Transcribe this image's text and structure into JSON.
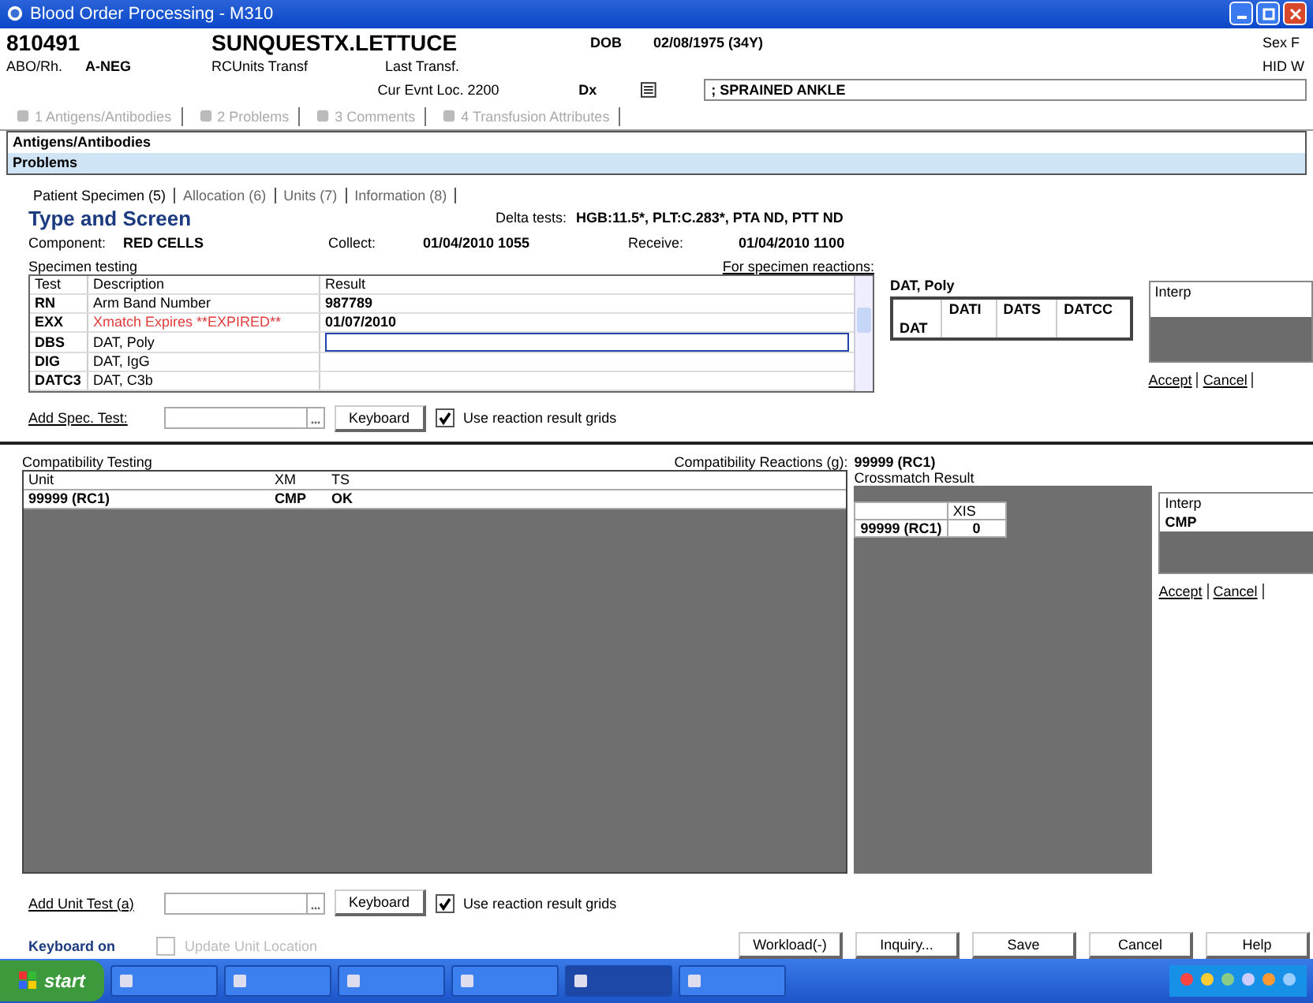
{
  "window": {
    "title": "Blood Order Processing - M310"
  },
  "header": {
    "mrn": "810491",
    "name": "SUNQUESTX.LETTUCE",
    "dob_label": "DOB",
    "dob": "02/08/1975 (34Y)",
    "sex_label": "Sex",
    "sex": "F",
    "abo_label": "ABO/Rh.",
    "abo": "A-NEG",
    "rc_label": "RCUnits Transf",
    "last_transf": "Last Transf.",
    "location": "Cur Evnt Loc. 2200",
    "dx_label": "Dx",
    "diagnosis": "; SPRAINED ANKLE",
    "hid_label": "HID",
    "hid": "W"
  },
  "section_tabs": [
    {
      "label": "1 Antigens/Antibodies",
      "disabled": true
    },
    {
      "label": "2 Problems",
      "disabled": true
    },
    {
      "label": "3 Comments",
      "disabled": true
    },
    {
      "label": "4 Transfusion Attributes",
      "disabled": true
    }
  ],
  "section_bars": [
    {
      "label": "Antigens/Antibodies",
      "selected": false
    },
    {
      "label": "Problems",
      "selected": true
    }
  ],
  "sub_tabs": [
    {
      "label": "Patient Specimen (5)",
      "selected": true
    },
    {
      "label": "Allocation (6)",
      "selected": false
    },
    {
      "label": "Units (7)",
      "selected": false
    },
    {
      "label": "Information (8)",
      "selected": false
    }
  ],
  "heading": "Type and Screen",
  "delta_label": "Delta tests:",
  "delta": "HGB:11.5*, PLT:C.283*, PTA ND, PTT ND",
  "component_label": "Component:",
  "component": "RED CELLS",
  "collect_label": "Collect:",
  "collect": "01/04/2010 1055",
  "receive_label": "Receive:",
  "receive": "01/04/2010 1100",
  "specimen": {
    "label": "Specimen testing",
    "link": "For specimen reactions:",
    "columns": [
      "Test",
      "Description",
      "Result"
    ],
    "rows": [
      {
        "test": "RN",
        "description": "Arm Band Number",
        "result": "987789",
        "alert": false,
        "editing": false
      },
      {
        "test": "EXX",
        "description": "Xmatch Expires **EXPIRED**",
        "result": "01/07/2010",
        "alert": true,
        "editing": false
      },
      {
        "test": "DBS",
        "description": "DAT, Poly",
        "result": "",
        "alert": false,
        "editing": true
      },
      {
        "test": "DIG",
        "description": "DAT, IgG",
        "alert": false,
        "editing": false
      },
      {
        "test": "DATC3",
        "description": "DAT, C3b",
        "alert": false,
        "editing": false
      }
    ]
  },
  "dat": {
    "title": "DAT, Poly",
    "columns": [
      "DATI",
      "DATS",
      "DATCC"
    ],
    "row": "DAT"
  },
  "interp": {
    "label": "Interp",
    "accept": "Accept",
    "cancel": "Cancel"
  },
  "add_spec": {
    "label": "Add Spec. Test:",
    "keyboard": "Keyboard",
    "checkbox": {
      "label": "Use reaction result grids",
      "checked": true
    }
  },
  "compat": {
    "title": "Compatibility Testing",
    "reactions_label": "Compatibility Reactions (g):",
    "reactions_unit": "99999 (RC1)",
    "columns": [
      "Unit",
      "XM",
      "TS"
    ],
    "rows": [
      [
        "99999 (RC1)",
        "CMP",
        "OK"
      ]
    ],
    "crossmatch_title": "Crossmatch Result",
    "xm_column": "XIS",
    "xm_rows": [
      {
        "unit": "99999 (RC1)",
        "value": "0"
      }
    ],
    "interp_label": "Interp",
    "interp_value": "CMP",
    "accept": "Accept",
    "cancel": "Cancel"
  },
  "add_unit": {
    "label": "Add Unit Test (a)",
    "keyboard": "Keyboard",
    "checkbox": {
      "label": "Use reaction result grids",
      "checked": true
    }
  },
  "footer": {
    "status": "Keyboard on",
    "checkbox": {
      "label": "Update Unit Location",
      "checked": false,
      "disabled": true
    },
    "buttons": [
      "Workload(-)",
      "Inquiry...",
      "Save",
      "Cancel",
      "Help"
    ]
  },
  "taskbar": {
    "start": "start",
    "tasks": [
      {
        "active": false
      },
      {
        "active": false
      },
      {
        "active": false
      },
      {
        "active": false
      },
      {
        "active": true
      },
      {
        "active": false
      }
    ]
  }
}
